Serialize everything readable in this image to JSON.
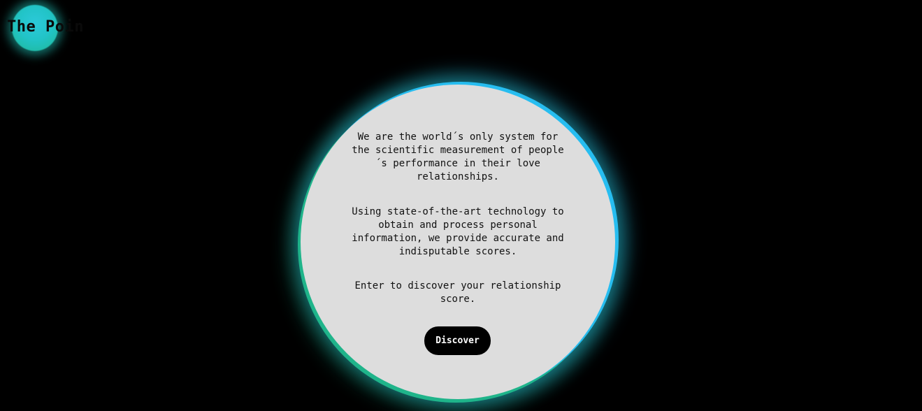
{
  "header": {
    "brand_text": "The Poin"
  },
  "intro": {
    "paragraph_1": "We are the world´s only system for the scientific measurement of people´s performance in their love relationships.",
    "paragraph_2": "Using state-of-the-art technology to obtain and process personal information, we provide accurate and indisputable scores.",
    "paragraph_3": "Enter to discover your relationship score."
  },
  "cta": {
    "discover_label": "Discover"
  },
  "colors": {
    "background": "#000000",
    "circle_fill": "#dddddd",
    "glow_blue": "#27bdf0",
    "glow_green": "#1fb48a",
    "button_bg": "#000000",
    "button_text": "#ffffff"
  },
  "icons": {
    "logo": "glowing-orb-icon"
  }
}
